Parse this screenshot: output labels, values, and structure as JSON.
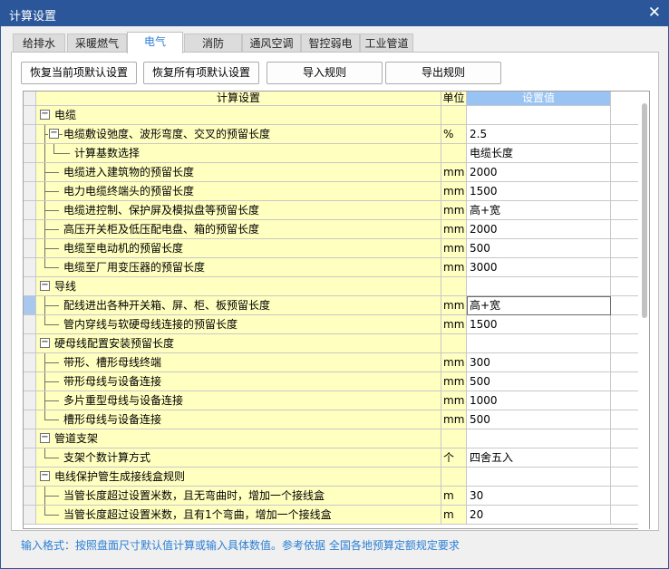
{
  "window": {
    "title": "计算设置",
    "close_glyph": "✕"
  },
  "tabs": [
    {
      "label": "给排水",
      "active": false
    },
    {
      "label": "采暖燃气",
      "active": false
    },
    {
      "label": "电气",
      "active": true
    },
    {
      "label": "消防",
      "active": false
    },
    {
      "label": "通风空调",
      "active": false
    },
    {
      "label": "智控弱电",
      "active": false
    },
    {
      "label": "工业管道",
      "active": false
    }
  ],
  "toolbar": {
    "restore_current": "恢复当前项默认设置",
    "restore_all": "恢复所有项默认设置",
    "import": "导入规则",
    "export": "导出规则"
  },
  "grid": {
    "headers": {
      "name": "计算设置",
      "unit": "单位",
      "value": "设置值"
    },
    "rows": [
      {
        "level": 0,
        "expander": "−",
        "name": "电缆",
        "unit": "",
        "value": ""
      },
      {
        "level": 1,
        "expander": "−",
        "name": "电缆敷设弛度、波形弯度、交叉的预留长度",
        "unit": "%",
        "value": "2.5"
      },
      {
        "level": 2,
        "name": "计算基数选择",
        "unit": "",
        "value": "电缆长度"
      },
      {
        "level": 1,
        "name": "电缆进入建筑物的预留长度",
        "unit": "mm",
        "value": "2000"
      },
      {
        "level": 1,
        "name": "电力电缆终端头的预留长度",
        "unit": "mm",
        "value": "1500"
      },
      {
        "level": 1,
        "name": "电缆进控制、保护屏及模拟盘等预留长度",
        "unit": "mm",
        "value": "高+宽"
      },
      {
        "level": 1,
        "name": "高压开关柜及低压配电盘、箱的预留长度",
        "unit": "mm",
        "value": "2000"
      },
      {
        "level": 1,
        "name": "电缆至电动机的预留长度",
        "unit": "mm",
        "value": "500"
      },
      {
        "level": 1,
        "name": "电缆至厂用变压器的预留长度",
        "unit": "mm",
        "value": "3000"
      },
      {
        "level": 0,
        "expander": "−",
        "name": "导线",
        "unit": "",
        "value": ""
      },
      {
        "level": 1,
        "name": "配线进出各种开关箱、屏、柜、板预留长度",
        "unit": "mm",
        "value": "高+宽",
        "selected": true
      },
      {
        "level": 1,
        "name": "管内穿线与软硬母线连接的预留长度",
        "unit": "mm",
        "value": "1500"
      },
      {
        "level": 0,
        "expander": "−",
        "name": "硬母线配置安装预留长度",
        "unit": "",
        "value": ""
      },
      {
        "level": 1,
        "name": "带形、槽形母线终端",
        "unit": "mm",
        "value": "300"
      },
      {
        "level": 1,
        "name": "带形母线与设备连接",
        "unit": "mm",
        "value": "500"
      },
      {
        "level": 1,
        "name": "多片重型母线与设备连接",
        "unit": "mm",
        "value": "1000"
      },
      {
        "level": 1,
        "name": "槽形母线与设备连接",
        "unit": "mm",
        "value": "500"
      },
      {
        "level": 0,
        "expander": "−",
        "name": "管道支架",
        "unit": "",
        "value": ""
      },
      {
        "level": 1,
        "name": "支架个数计算方式",
        "unit": "个",
        "value": "四舍五入"
      },
      {
        "level": 0,
        "expander": "−",
        "name": "电线保护管生成接线盒规则",
        "unit": "",
        "value": ""
      },
      {
        "level": 1,
        "name": "当管长度超过设置米数，且无弯曲时，增加一个接线盒",
        "unit": "m",
        "value": "30"
      },
      {
        "level": 1,
        "name": "当管长度超过设置米数，且有1个弯曲，增加一个接线盒",
        "unit": "m",
        "value": "20"
      }
    ]
  },
  "footer": {
    "hint": "输入格式：按照盘面尺寸默认值计算或输入具体数值。参考依据 全国各地预算定额规定要求"
  },
  "colors": {
    "title_bar": "#2b579a",
    "name_cell": "#ffffc0",
    "value_header": "#99c3f2",
    "accent": "#2b7fd4"
  }
}
